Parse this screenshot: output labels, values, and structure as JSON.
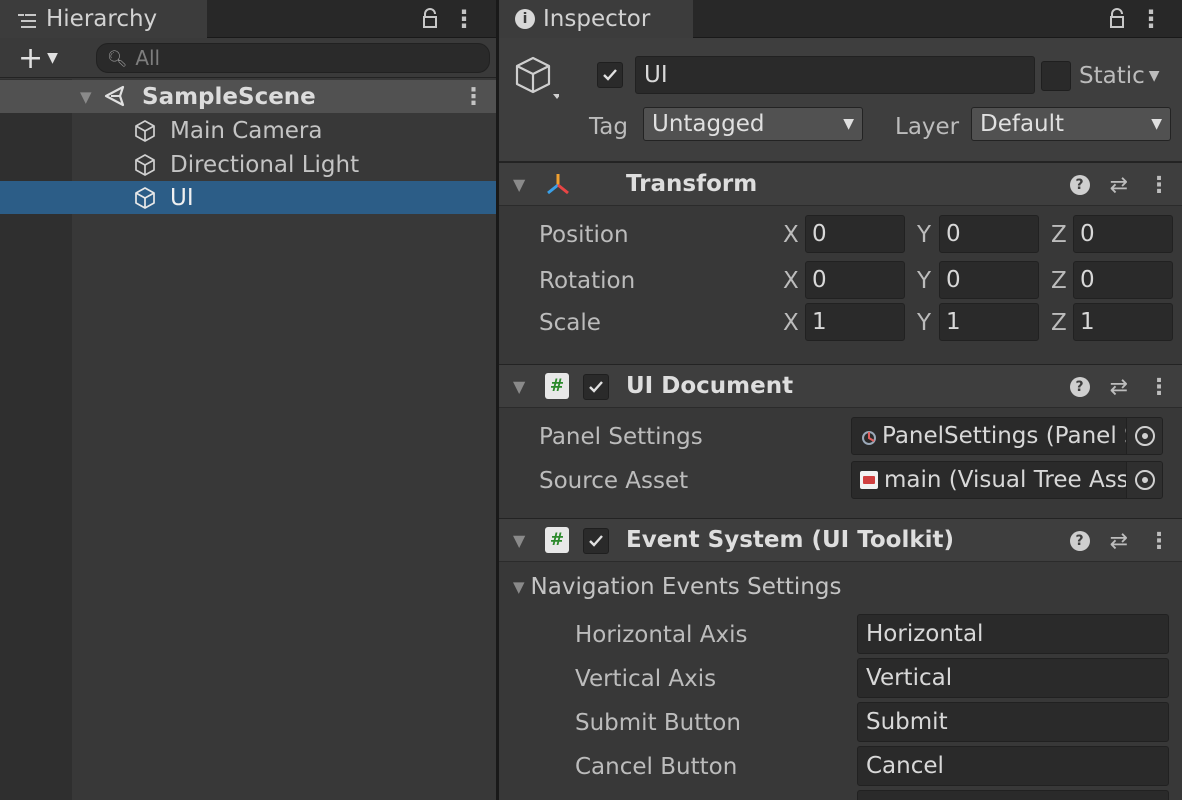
{
  "hierarchy": {
    "tab_label": "Hierarchy",
    "search_placeholder": "All",
    "scene": {
      "name": "SampleScene"
    },
    "items": [
      {
        "label": "Main Camera"
      },
      {
        "label": "Directional Light"
      },
      {
        "label": "UI",
        "selected": true
      }
    ],
    "selection_color": "#2c5d87"
  },
  "inspector": {
    "tab_label": "Inspector",
    "object": {
      "name": "UI",
      "active": true,
      "static_label": "Static",
      "static_checked": false,
      "tag_label": "Tag",
      "tag_value": "Untagged",
      "layer_label": "Layer",
      "layer_value": "Default"
    },
    "transform": {
      "title": "Transform",
      "rows": [
        {
          "label": "Position",
          "x": "0",
          "y": "0",
          "z": "0"
        },
        {
          "label": "Rotation",
          "x": "0",
          "y": "0",
          "z": "0"
        },
        {
          "label": "Scale",
          "x": "1",
          "y": "1",
          "z": "1"
        }
      ],
      "axis_labels": {
        "x": "X",
        "y": "Y",
        "z": "Z"
      }
    },
    "ui_document": {
      "title": "UI Document",
      "enabled": true,
      "fields": [
        {
          "label": "Panel Settings",
          "value": "PanelSettings (Panel Settings)"
        },
        {
          "label": "Source Asset",
          "value": "main (Visual Tree Asset)"
        }
      ]
    },
    "event_system": {
      "title": "Event System (UI Toolkit)",
      "enabled": true,
      "foldout_label": "Navigation Events Settings",
      "fields": [
        {
          "label": "Horizontal Axis",
          "value": "Horizontal"
        },
        {
          "label": "Vertical Axis",
          "value": "Vertical"
        },
        {
          "label": "Submit Button",
          "value": "Submit"
        },
        {
          "label": "Cancel Button",
          "value": "Cancel"
        }
      ]
    }
  }
}
